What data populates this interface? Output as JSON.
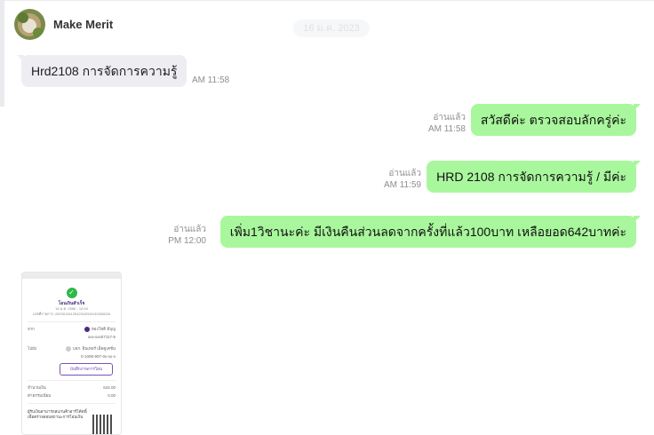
{
  "contact": {
    "name": "Make Merit"
  },
  "date_chip": "16 ม.ค. 2023",
  "messages": [
    {
      "direction": "in",
      "text": "Hrd2108 การจัดการความรู้",
      "time": "AM 11:58"
    },
    {
      "direction": "out",
      "text": "สวัสดีค่ะ ตรวจสอบลักครู่ค่ะ",
      "read": "อ่านแล้ว",
      "time": "AM 11:58"
    },
    {
      "direction": "out",
      "text": "HRD 2108 การจัดการความรู้ / มีค่ะ",
      "read": "อ่านแล้ว",
      "time": "AM 11:59"
    },
    {
      "direction": "out",
      "text": "เพิ่ม1วิชานะค่ะ มีเงินคืนส่วนลดจากครั้งที่แล้ว100บาท เหลือยอด642บาทค่ะ",
      "read": "อ่านแล้ว",
      "time": "PM 12:00"
    }
  ],
  "receipt": {
    "title": "โอนเงินสำเร็จ",
    "datetime": "16 ม.ค. 2566 - 12:04",
    "ref": "เลขที่รายการ: 2023011612042910000132000026",
    "from_label": "จาก",
    "from_name": "ทองโชติ มีบุญ",
    "from_acct": "xxx-xxx07117-5",
    "to_label": "ไปยัง",
    "to_name": "บจก. อินเทอร์ เอ็ดดูเคชั่น",
    "to_acct": "0-1006-907-0x-xx-x",
    "save_button": "บันทึกภาพการโอน",
    "amount_label": "จำนวนเงิน",
    "amount": "642.00",
    "fee_label": "ค่าธรรมเนียม",
    "fee": "0.00",
    "footer": "ผู้รับเงินสามารถสแกนคิวอาร์โค้ดนี้ เพื่อตรวจสอบสถานะการโอนเงิน"
  },
  "colors": {
    "outgoing": "#a9f79d",
    "incoming": "#ededf2",
    "accent": "#4d2a82"
  }
}
